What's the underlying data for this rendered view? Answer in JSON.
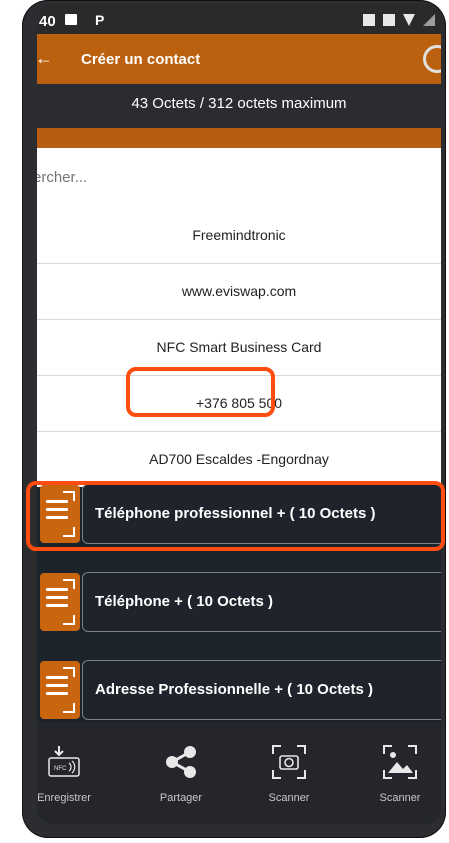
{
  "status_bar": {
    "time": "40",
    "extra": "P"
  },
  "toolbar": {
    "title": "Créer un contact",
    "back": "←"
  },
  "size_info": "43 Octets / 312 octets maximum",
  "search": {
    "placeholder": "ercher..."
  },
  "contact_values": [
    "Freemindtronic",
    "www.eviswap.com",
    "NFC Smart Business Card",
    "+376 805 500",
    "AD700 Escaldes -Engordnay"
  ],
  "fields": [
    {
      "label": "Téléphone professionnel + ( 10 Octets )"
    },
    {
      "label": "Téléphone  + ( 10 Octets )"
    },
    {
      "label": "Adresse Professionnelle + ( 10 Octets )"
    }
  ],
  "bottom_nav": {
    "save": "Enregistrer",
    "share": "Partager",
    "scan_camera": "Scanner",
    "scan_image": "Scanner",
    "nfc_tag": "NFC"
  },
  "colors": {
    "brand_orange": "#ba600f",
    "highlight": "#ff4d10",
    "dark_bg": "#1d232b"
  }
}
